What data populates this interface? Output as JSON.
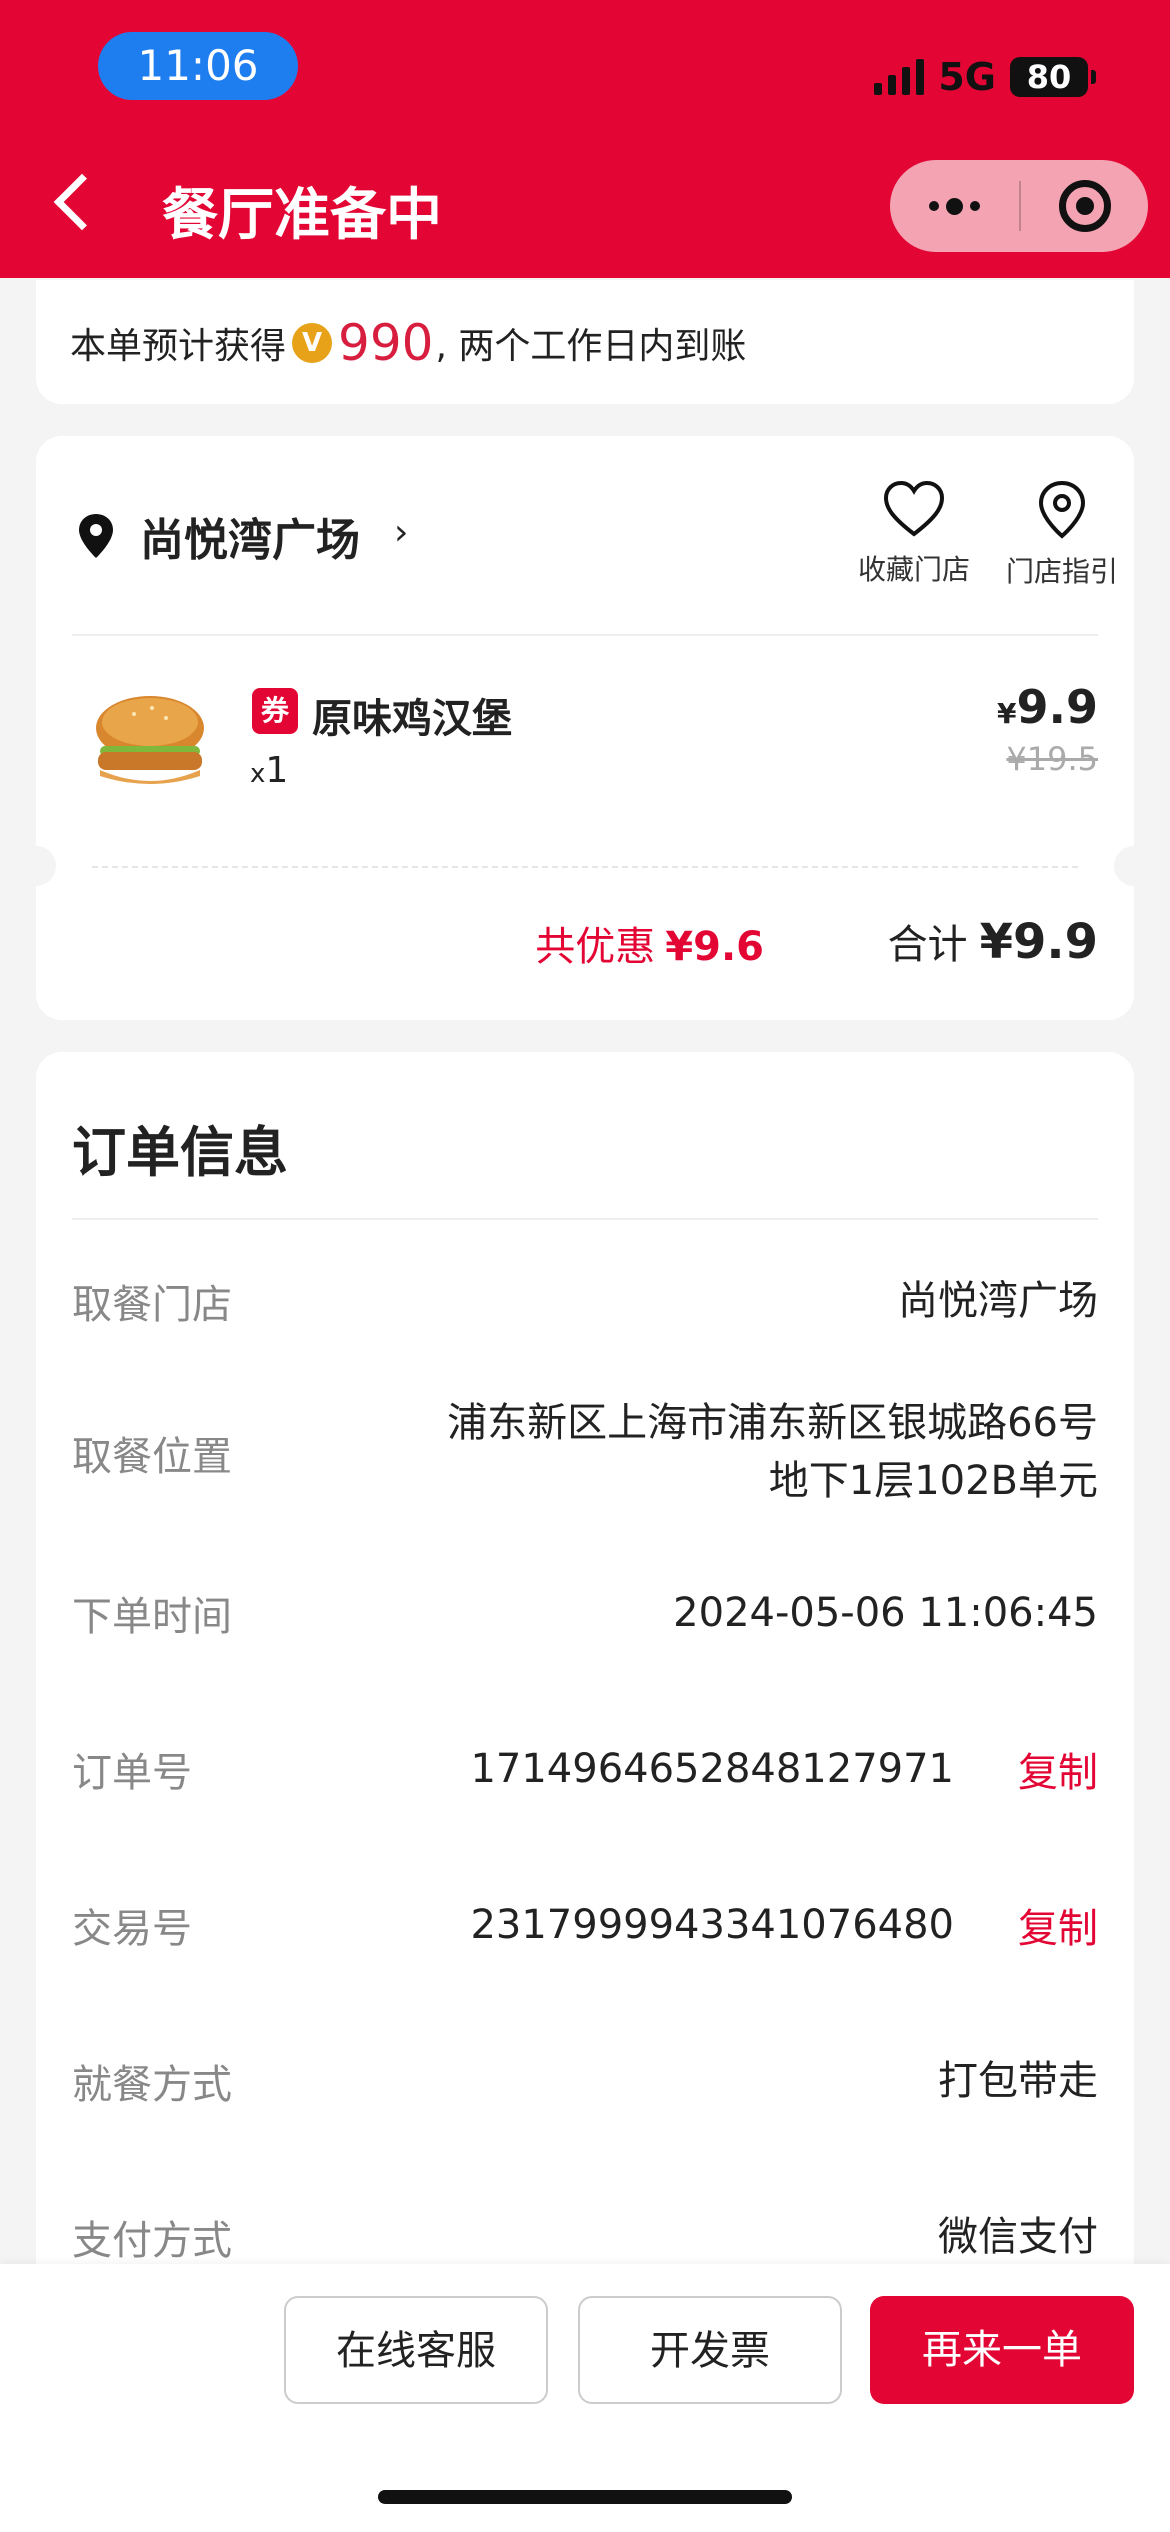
{
  "status_bar": {
    "time": "11:06",
    "network": "5G",
    "battery": "80"
  },
  "nav": {
    "title": "餐厅准备中"
  },
  "points": {
    "prefix": "本单预计获得",
    "coin_symbol": "V",
    "amount": "990",
    "suffix": ", 两个工作日内到账"
  },
  "store": {
    "name": "尚悦湾广场",
    "favorite_label": "收藏门店",
    "guide_label": "门店指引"
  },
  "item": {
    "tag": "券",
    "name": "原味鸡汉堡",
    "qty_prefix": "x",
    "qty": "1",
    "currency": "¥",
    "price": "9.9",
    "original_price": "¥19.5"
  },
  "summary": {
    "discount_label": "共优惠",
    "discount_value": "¥9.6",
    "total_label": "合计",
    "total_value": "¥9.9"
  },
  "order_info": {
    "title": "订单信息",
    "rows": [
      {
        "label": "取餐门店",
        "value": "尚悦湾广场"
      },
      {
        "label": "取餐位置",
        "value_line1": "浦东新区上海市浦东新区银城路66号",
        "value_line2": "地下1层102B单元"
      },
      {
        "label": "下单时间",
        "value": "2024-05-06 11:06:45"
      },
      {
        "label": "订单号",
        "value": "1714964652848127971",
        "action": "复制"
      },
      {
        "label": "交易号",
        "value": "2317999943341076480",
        "action": "复制"
      },
      {
        "label": "就餐方式",
        "value": "打包带走"
      },
      {
        "label": "支付方式",
        "value": "微信支付"
      }
    ]
  },
  "bottom": {
    "service": "在线客服",
    "invoice": "开发票",
    "reorder": "再来一单"
  },
  "colors": {
    "brand_red": "#e30634",
    "time_pill": "#1e7ef0",
    "coin": "#e8a21a"
  }
}
